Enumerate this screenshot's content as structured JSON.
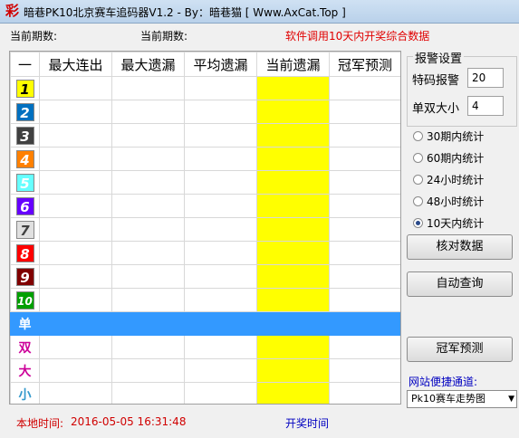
{
  "window": {
    "title": "暗巷PK10北京赛车追码器V1.2 - By：暗巷猫  [ Www.AxCat.Top ]",
    "app_icon": "彩"
  },
  "info": {
    "current_period_1": "当前期数:",
    "current_period_2": "当前期数:",
    "notice": "软件调用10天内开奖综合数据"
  },
  "grid": {
    "headers": [
      "一",
      "最大连出",
      "最大遗漏",
      "平均遗漏",
      "当前遗漏",
      "冠军预测"
    ],
    "numbers": [
      {
        "label": "1",
        "color": "#ffff00",
        "text_color": "#000000"
      },
      {
        "label": "2",
        "color": "#0070c0",
        "text_color": "#ffffff"
      },
      {
        "label": "3",
        "color": "#404040",
        "text_color": "#ffffff"
      },
      {
        "label": "4",
        "color": "#ff8000",
        "text_color": "#ffffff"
      },
      {
        "label": "5",
        "color": "#66ffff",
        "text_color": "#ffffff"
      },
      {
        "label": "6",
        "color": "#6600ff",
        "text_color": "#ffffff"
      },
      {
        "label": "7",
        "color": "#e0e0e0",
        "text_color": "#404040"
      },
      {
        "label": "8",
        "color": "#ff0000",
        "text_color": "#ffffff"
      },
      {
        "label": "9",
        "color": "#800000",
        "text_color": "#ffffff"
      },
      {
        "label": "10",
        "color": "#00a000",
        "text_color": "#ffffff"
      }
    ],
    "tags": [
      {
        "label": "单",
        "color": "#ffffff",
        "selected": true
      },
      {
        "label": "双",
        "color": "#cc0099",
        "selected": false
      },
      {
        "label": "大",
        "color": "#cc0099",
        "selected": false
      },
      {
        "label": "小",
        "color": "#3399cc",
        "selected": false
      }
    ]
  },
  "alarm": {
    "title": "报警设置",
    "special_label": "特码报警",
    "special_value": "20",
    "oddeven_label": "单双大小",
    "oddeven_value": "4"
  },
  "stats_options": [
    {
      "label": "30期内统计",
      "checked": false
    },
    {
      "label": "60期内统计",
      "checked": false
    },
    {
      "label": "24小时统计",
      "checked": false
    },
    {
      "label": "48小时统计",
      "checked": false
    },
    {
      "label": "10天内统计",
      "checked": true
    }
  ],
  "buttons": {
    "verify": "核对数据",
    "auto_query": "自动查询",
    "predict": "冠军预测"
  },
  "site": {
    "label": "网站便捷通道:",
    "selected": "Pk10赛车走势图"
  },
  "status": {
    "local_time_label": "本地时间:",
    "local_time_value": "2016-05-05 16:31:48",
    "draw_time_label": "开奖时间"
  }
}
